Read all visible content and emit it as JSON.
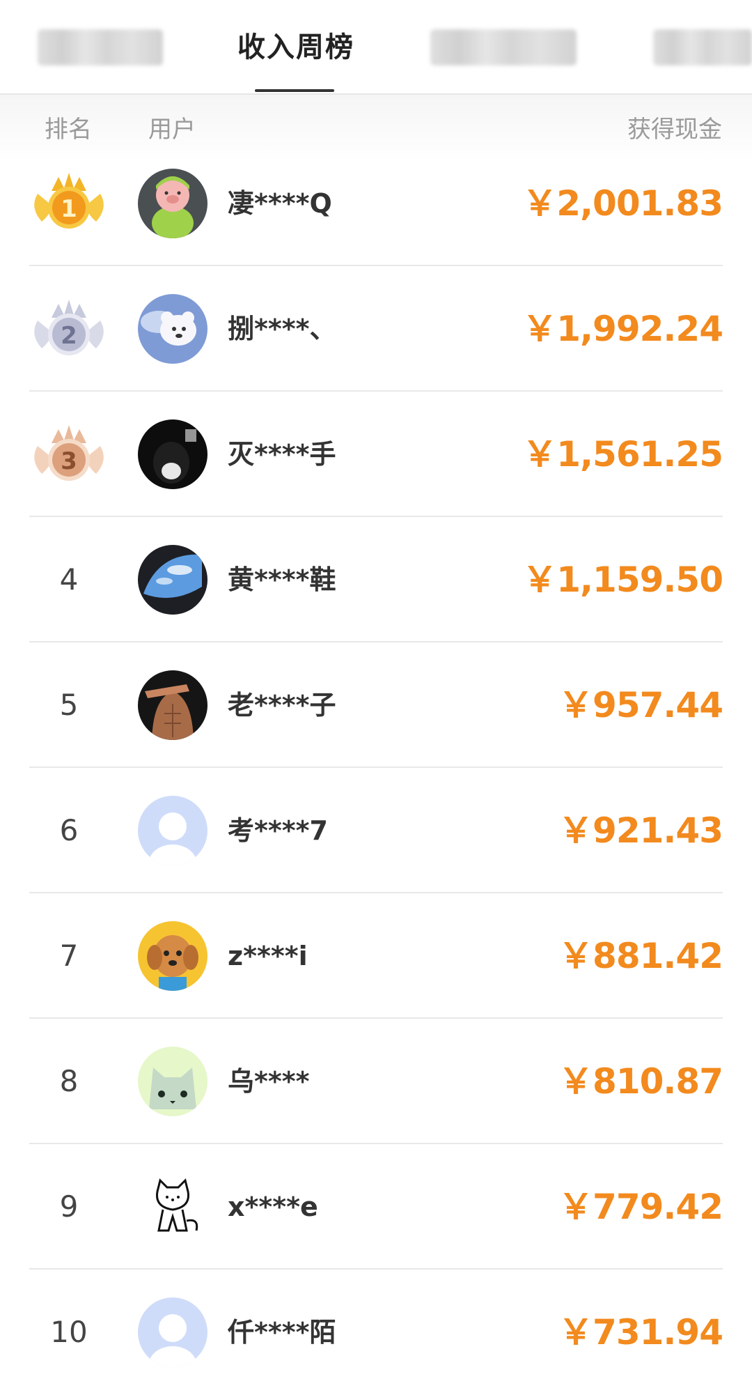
{
  "tabs": {
    "active_label": "收入周榜"
  },
  "columns": {
    "rank": "排名",
    "user": "用户",
    "cash": "获得现金"
  },
  "currency_symbol": "￥",
  "accent_color": "#f28a1e",
  "rows": [
    {
      "rank": "1",
      "name": "凄****Q",
      "amount": "￥2,001.83",
      "badge": "gold-crown-medal-icon",
      "avatar": "pig-avatar"
    },
    {
      "rank": "2",
      "name": "捌****、",
      "amount": "￥1,992.24",
      "badge": "silver-crown-medal-icon",
      "avatar": "sky-bear-avatar"
    },
    {
      "rank": "3",
      "name": "灭****手",
      "amount": "￥1,561.25",
      "badge": "bronze-crown-medal-icon",
      "avatar": "dark-portrait-avatar"
    },
    {
      "rank": "4",
      "name": "黄****鞋",
      "amount": "￥1,159.50",
      "avatar": "sky-window-avatar"
    },
    {
      "rank": "5",
      "name": "老****子",
      "amount": "￥957.44",
      "avatar": "muscle-avatar"
    },
    {
      "rank": "6",
      "name": "考****7",
      "amount": "￥921.43",
      "avatar": "default-avatar"
    },
    {
      "rank": "7",
      "name": "z****i",
      "amount": "￥881.42",
      "avatar": "dog-avatar"
    },
    {
      "rank": "8",
      "name": "乌****",
      "amount": "￥810.87",
      "avatar": "cat-face-avatar"
    },
    {
      "rank": "9",
      "name": "x****e",
      "amount": "￥779.42",
      "avatar": "doodle-cat-avatar"
    },
    {
      "rank": "10",
      "name": "仟****陌",
      "amount": "￥731.94",
      "avatar": "default-avatar"
    }
  ]
}
